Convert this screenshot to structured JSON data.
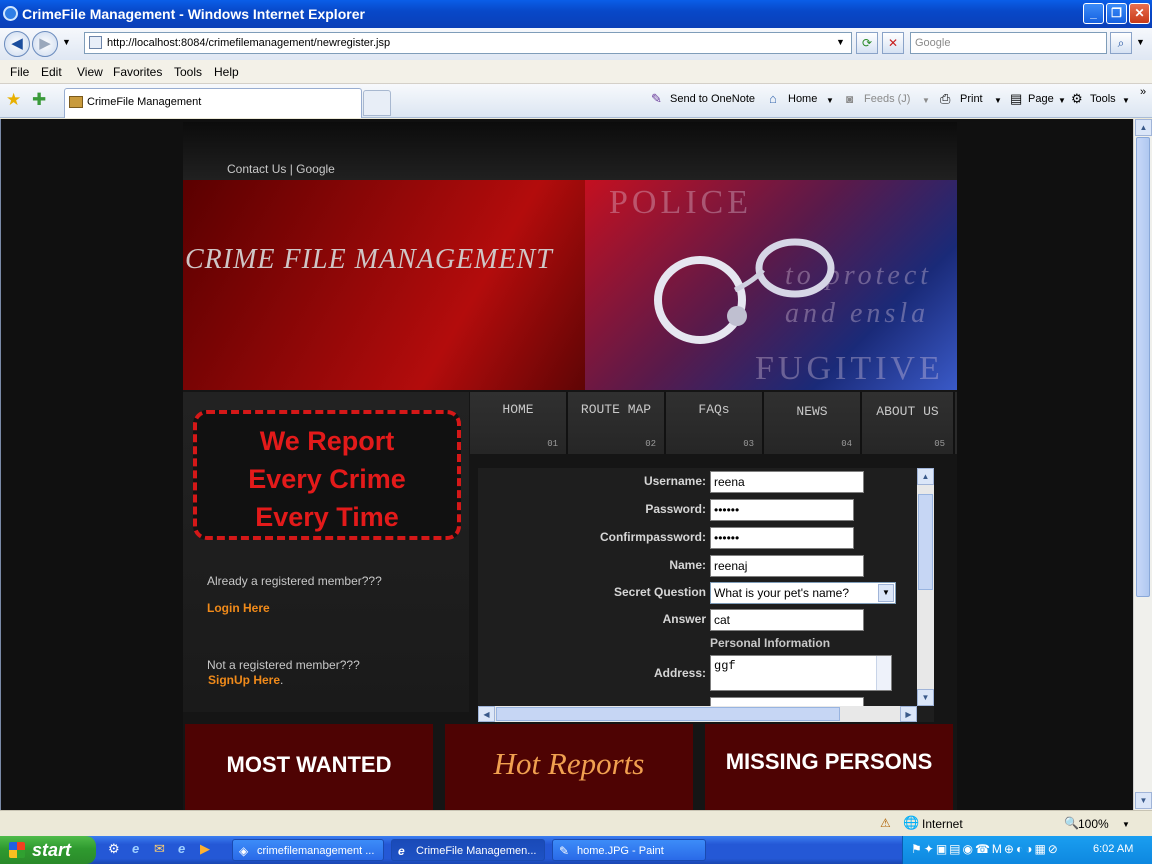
{
  "window": {
    "title": "CrimeFile Management - Windows Internet Explorer"
  },
  "browser": {
    "address": "http://localhost:8084/crimefilemanagement/newregister.jsp",
    "search_placeholder": "Google",
    "menu": [
      "File",
      "Edit",
      "View",
      "Favorites",
      "Tools",
      "Help"
    ],
    "tab_title": "CrimeFile Management",
    "commands": {
      "onenote": "Send to OneNote",
      "home": "Home",
      "feeds": "Feeds (J)",
      "print": "Print",
      "page": "Page",
      "tools": "Tools"
    }
  },
  "site": {
    "top_links": "Contact Us | Google",
    "banner_title": "CRIME FILE MANAGEMENT",
    "banner_words": {
      "police": "POLICE",
      "protect": "to protect",
      "enslave": "and ensla",
      "fugitive": "FUGITIVE"
    },
    "slogan": [
      "We Report",
      "Every Crime",
      "Every Time"
    ],
    "already_member": "Already a registered member???",
    "login_link": "Login Here",
    "not_member": "Not a registered member???",
    "signup_link": "SignUp Here",
    "signup_suffix": ".",
    "nav": [
      {
        "label": "HOME",
        "num": "01"
      },
      {
        "label": "ROUTE MAP",
        "num": "02"
      },
      {
        "label": "FAQs",
        "num": "03"
      },
      {
        "label": "NEWS",
        "num": "04"
      },
      {
        "label": "ABOUT US",
        "num": "05"
      }
    ],
    "form": {
      "username_label": "Username:",
      "username_value": "reena",
      "password_label": "Password:",
      "password_value": "••••••",
      "confirm_label": "Confirmpassword:",
      "confirm_value": "••••••",
      "name_label": "Name:",
      "name_value": "reenaj",
      "secret_label": "Secret Question",
      "secret_value": "What is your pet's name?",
      "answer_label": "Answer",
      "answer_value": "cat",
      "section_personal": "Personal Information",
      "address_label": "Address:",
      "address_value": "ggf"
    },
    "bottom": {
      "most_wanted": "MOST WANTED",
      "hot_reports": "Hot Reports",
      "missing_persons": "MISSING PERSONS"
    }
  },
  "status": {
    "zone": "Internet",
    "zoom": "100%"
  },
  "taskbar": {
    "start": "start",
    "tasks": [
      "crimefilemanagement ...",
      "CrimeFile Managemen...",
      "home.JPG - Paint"
    ],
    "clock": "6:02 AM"
  }
}
